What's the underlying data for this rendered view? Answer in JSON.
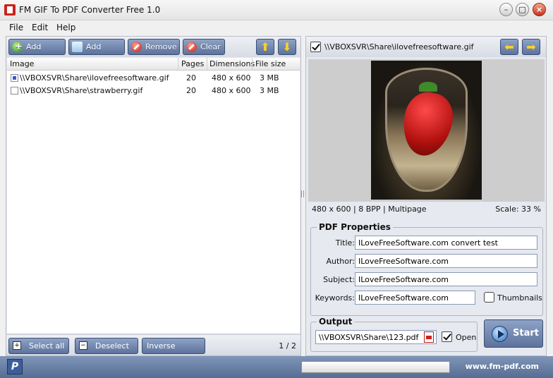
{
  "window": {
    "title": "FM GIF To PDF Converter Free 1.0"
  },
  "menu": [
    "File",
    "Edit",
    "Help"
  ],
  "toolbar": {
    "add_image": "Add image",
    "add_folder": "Add folder",
    "remove": "Remove",
    "clear": "Clear"
  },
  "table": {
    "headers": [
      "Image",
      "Pages",
      "Dimensions",
      "File size"
    ],
    "rows": [
      {
        "checked": true,
        "image": "\\\\VBOXSVR\\Share\\ilovefreesoftware.gif",
        "pages": "20",
        "dimensions": "480 x 600",
        "size": "3 MB"
      },
      {
        "checked": false,
        "image": "\\\\VBOXSVR\\Share\\strawberry.gif",
        "pages": "20",
        "dimensions": "480 x 600",
        "size": "3 MB"
      }
    ]
  },
  "bottom": {
    "select_all": "Select all",
    "deselect_all": "Deselect all",
    "inverse_selection": "Inverse selection",
    "page_count": "1 / 2"
  },
  "preview": {
    "path": "\\\\VBOXSVR\\Share\\ilovefreesoftware.gif",
    "info": "480 x 600  |  8 BPP  |  Multipage",
    "scale": "Scale: 33 %"
  },
  "pdf_properties": {
    "legend": "PDF Properties",
    "title_label": "Title:",
    "title_value": "ILoveFreeSoftware.com convert test",
    "author_label": "Author:",
    "author_value": "ILoveFreeSoftware.com",
    "subject_label": "Subject:",
    "subject_value": "ILoveFreeSoftware.com",
    "keywords_label": "Keywords:",
    "keywords_value": "ILoveFreeSoftware.com",
    "thumbnails_label": "Thumbnails"
  },
  "output": {
    "legend": "Output",
    "path": "\\\\VBOXSVR\\Share\\123.pdf",
    "open_label": "Open"
  },
  "start_label": "Start",
  "status": {
    "site": "www.fm-pdf.com"
  }
}
